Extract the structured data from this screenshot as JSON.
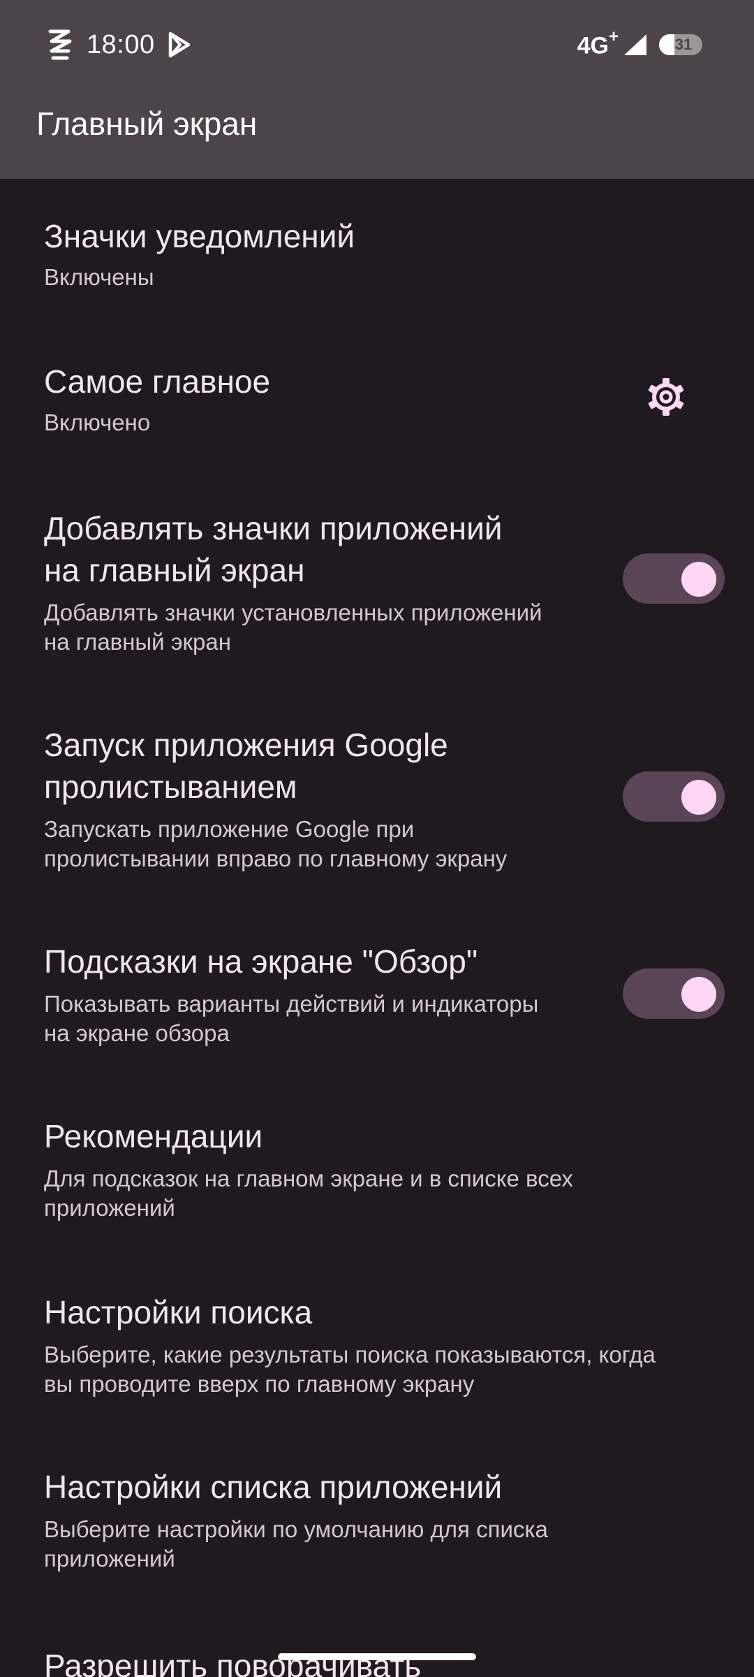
{
  "status_bar": {
    "time": "18:00",
    "network": "4G",
    "network_plus": "+",
    "battery": "31"
  },
  "header": {
    "title": "Главный экран"
  },
  "settings": [
    {
      "title": "Значки уведомлений",
      "summary": "Включены"
    },
    {
      "title": "Самое главное",
      "summary": "Включено",
      "action_icon": "gear-icon"
    },
    {
      "title_line1": "Добавлять значки приложений",
      "title_line2": "на главный экран",
      "summary_line1": "Добавлять значки установленных приложений",
      "summary_line2": "на главный экран",
      "toggle_on": true
    },
    {
      "title_line1": "Запуск приложения Google",
      "title_line2": "пролистыванием",
      "summary_line1": "Запускать приложение Google при",
      "summary_line2": "пролистывании вправо по главному экрану",
      "toggle_on": true
    },
    {
      "title": "Подсказки на экране \"Обзор\"",
      "summary_line1": "Показывать варианты действий и индикаторы",
      "summary_line2": "на экране обзора",
      "toggle_on": true
    },
    {
      "title": "Рекомендации",
      "summary_line1": "Для подсказок на главном экране и в списке всех",
      "summary_line2": "приложений"
    },
    {
      "title": "Настройки поиска",
      "summary_line1": "Выберите, какие результаты поиска показываются, когда",
      "summary_line2": "вы проводите вверх по главному экрану"
    },
    {
      "title": "Настройки списка приложений",
      "summary_line1": "Выберите настройки по умолчанию для списка",
      "summary_line2": "приложений"
    },
    {
      "title": "Разрешить поворачивать"
    }
  ],
  "colors": {
    "background": "#201a1f",
    "header": "#4d4449",
    "toggle_track": "#5a4556",
    "toggle_thumb": "#ffd7f4",
    "accent_icon": "#ffd7f4"
  }
}
